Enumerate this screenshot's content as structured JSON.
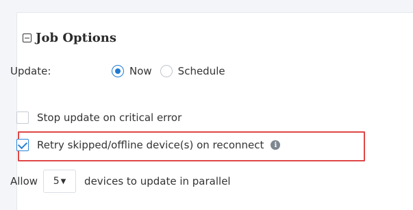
{
  "panel": {
    "title": "Job Options"
  },
  "update": {
    "label": "Update:",
    "options": [
      {
        "label": "Now",
        "selected": true
      },
      {
        "label": "Schedule",
        "selected": false
      }
    ]
  },
  "checks": {
    "stop_update": {
      "label": "Stop update on critical error",
      "checked": false
    },
    "retry": {
      "label": "Retry skipped/offline device(s) on reconnect",
      "checked": true,
      "info_icon": "info-icon"
    }
  },
  "parallel": {
    "prefix": "Allow",
    "value": "5",
    "suffix": "devices to update in parallel"
  },
  "colors": {
    "accent": "#1f7bd1",
    "highlight": "#e04545"
  }
}
